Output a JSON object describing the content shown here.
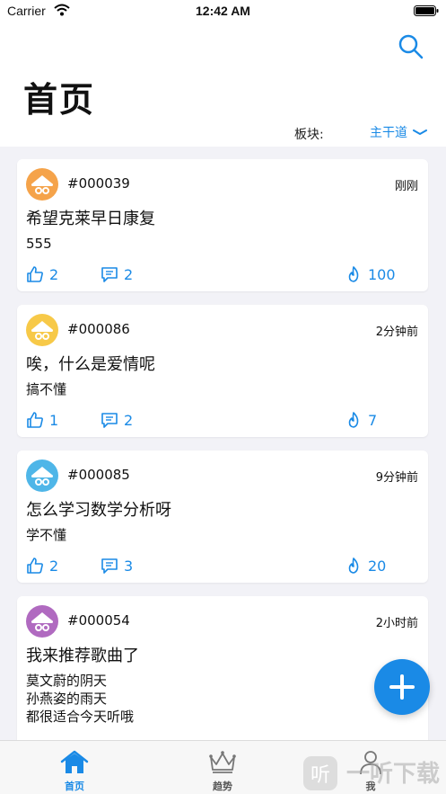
{
  "status_bar": {
    "carrier": "Carrier",
    "time": "12:42 AM"
  },
  "header": {
    "title": "首页",
    "board_label": "板块:",
    "board_value": "主干道"
  },
  "posts": [
    {
      "id": "#000039",
      "time": "刚刚",
      "title": "希望克莱早日康复",
      "body": [
        "555"
      ],
      "likes": "2",
      "comments": "2",
      "heat": "100",
      "avatar_color": "#f5a34a"
    },
    {
      "id": "#000086",
      "time": "2分钟前",
      "title": "唉，什么是爱情呢",
      "body": [
        "搞不懂"
      ],
      "likes": "1",
      "comments": "2",
      "heat": "7",
      "avatar_color": "#f7c948"
    },
    {
      "id": "#000085",
      "time": "9分钟前",
      "title": "怎么学习数学分析呀",
      "body": [
        "学不懂"
      ],
      "likes": "2",
      "comments": "3",
      "heat": "20",
      "avatar_color": "#4fb6e8"
    },
    {
      "id": "#000054",
      "time": "2小时前",
      "title": "我来推荐歌曲了",
      "body": [
        "莫文蔚的阴天",
        "孙燕姿的雨天",
        "都很适合今天听哦"
      ],
      "likes": "",
      "comments": "",
      "heat": "",
      "avatar_color": "#b06ac0"
    }
  ],
  "tabs": [
    {
      "label": "首页",
      "icon": "home-icon",
      "active": true
    },
    {
      "label": "趋势",
      "icon": "crown-icon",
      "active": false
    },
    {
      "label": "我",
      "icon": "person-icon",
      "active": false
    }
  ],
  "colors": {
    "accent": "#1a8ae6",
    "background": "#f2f2f7"
  },
  "watermark": {
    "text": "一听下载"
  }
}
